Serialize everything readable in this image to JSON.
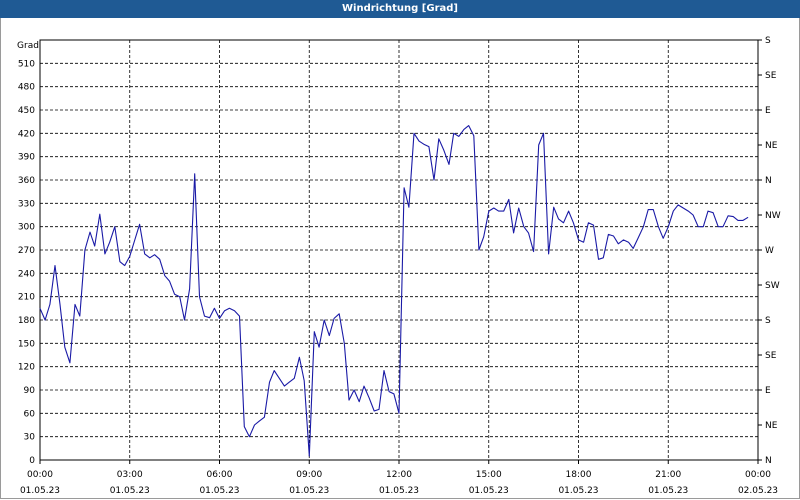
{
  "window": {
    "title": "Windrichtung [Grad]"
  },
  "chart_data": {
    "type": "line",
    "title": "Windrichtung [Grad]",
    "ylabel": "Grad",
    "ylim": [
      0,
      540
    ],
    "yticks": [
      0,
      30,
      60,
      90,
      120,
      150,
      180,
      210,
      240,
      270,
      300,
      330,
      360,
      390,
      420,
      450,
      480,
      510
    ],
    "right_axis_labels": [
      {
        "value": 0,
        "label": "N"
      },
      {
        "value": 45,
        "label": "NE"
      },
      {
        "value": 90,
        "label": "E"
      },
      {
        "value": 135,
        "label": "SE"
      },
      {
        "value": 180,
        "label": "S"
      },
      {
        "value": 225,
        "label": "SW"
      },
      {
        "value": 270,
        "label": "W"
      },
      {
        "value": 315,
        "label": "NW"
      },
      {
        "value": 360,
        "label": "N"
      },
      {
        "value": 405,
        "label": "NE"
      },
      {
        "value": 450,
        "label": "E"
      },
      {
        "value": 495,
        "label": "SE"
      },
      {
        "value": 540,
        "label": "S"
      }
    ],
    "xlim_hours": [
      0,
      24
    ],
    "xticks": [
      {
        "hour": 0,
        "time": "00:00",
        "date": "01.05.23"
      },
      {
        "hour": 3,
        "time": "03:00",
        "date": "01.05.23"
      },
      {
        "hour": 6,
        "time": "06:00",
        "date": "01.05.23"
      },
      {
        "hour": 9,
        "time": "09:00",
        "date": "01.05.23"
      },
      {
        "hour": 12,
        "time": "12:00",
        "date": "01.05.23"
      },
      {
        "hour": 15,
        "time": "15:00",
        "date": "01.05.23"
      },
      {
        "hour": 18,
        "time": "18:00",
        "date": "01.05.23"
      },
      {
        "hour": 21,
        "time": "21:00",
        "date": "01.05.23"
      },
      {
        "hour": 24,
        "time": "00:00",
        "date": "02.05.23"
      }
    ],
    "grid": true,
    "series": [
      {
        "name": "",
        "color": "#1a1aa6",
        "points": [
          [
            0.0,
            195
          ],
          [
            0.17,
            180
          ],
          [
            0.33,
            200
          ],
          [
            0.5,
            250
          ],
          [
            0.67,
            200
          ],
          [
            0.83,
            145
          ],
          [
            1.0,
            125
          ],
          [
            1.17,
            200
          ],
          [
            1.33,
            185
          ],
          [
            1.5,
            270
          ],
          [
            1.67,
            293
          ],
          [
            1.83,
            275
          ],
          [
            2.0,
            316
          ],
          [
            2.17,
            265
          ],
          [
            2.33,
            280
          ],
          [
            2.5,
            300
          ],
          [
            2.67,
            255
          ],
          [
            2.83,
            250
          ],
          [
            3.0,
            262
          ],
          [
            3.17,
            283
          ],
          [
            3.33,
            303
          ],
          [
            3.5,
            265
          ],
          [
            3.67,
            260
          ],
          [
            3.83,
            264
          ],
          [
            4.0,
            258
          ],
          [
            4.17,
            237
          ],
          [
            4.33,
            230
          ],
          [
            4.5,
            213
          ],
          [
            4.67,
            210
          ],
          [
            4.83,
            180
          ],
          [
            5.0,
            220
          ],
          [
            5.17,
            368
          ],
          [
            5.33,
            210
          ],
          [
            5.5,
            185
          ],
          [
            5.67,
            183
          ],
          [
            5.83,
            195
          ],
          [
            6.0,
            182
          ],
          [
            6.17,
            192
          ],
          [
            6.33,
            195
          ],
          [
            6.5,
            192
          ],
          [
            6.67,
            185
          ],
          [
            6.83,
            43
          ],
          [
            7.0,
            30
          ],
          [
            7.17,
            45
          ],
          [
            7.33,
            50
          ],
          [
            7.5,
            55
          ],
          [
            7.67,
            100
          ],
          [
            7.83,
            115
          ],
          [
            8.0,
            105
          ],
          [
            8.17,
            95
          ],
          [
            8.33,
            100
          ],
          [
            8.5,
            105
          ],
          [
            8.67,
            132
          ],
          [
            8.83,
            102
          ],
          [
            9.0,
            5
          ],
          [
            9.17,
            165
          ],
          [
            9.33,
            145
          ],
          [
            9.5,
            180
          ],
          [
            9.67,
            160
          ],
          [
            9.83,
            182
          ],
          [
            10.0,
            188
          ],
          [
            10.17,
            150
          ],
          [
            10.33,
            77
          ],
          [
            10.5,
            90
          ],
          [
            10.67,
            75
          ],
          [
            10.83,
            95
          ],
          [
            11.0,
            80
          ],
          [
            11.17,
            63
          ],
          [
            11.33,
            65
          ],
          [
            11.5,
            115
          ],
          [
            11.67,
            88
          ],
          [
            11.83,
            85
          ],
          [
            12.0,
            60
          ],
          [
            12.17,
            350
          ],
          [
            12.33,
            325
          ],
          [
            12.5,
            420
          ],
          [
            12.67,
            410
          ],
          [
            12.83,
            406
          ],
          [
            13.0,
            403
          ],
          [
            13.17,
            360
          ],
          [
            13.33,
            413
          ],
          [
            13.5,
            398
          ],
          [
            13.67,
            380
          ],
          [
            13.83,
            420
          ],
          [
            14.0,
            416
          ],
          [
            14.17,
            425
          ],
          [
            14.33,
            430
          ],
          [
            14.5,
            417
          ],
          [
            14.67,
            270
          ],
          [
            14.83,
            287
          ],
          [
            15.0,
            320
          ],
          [
            15.17,
            324
          ],
          [
            15.33,
            320
          ],
          [
            15.5,
            320
          ],
          [
            15.67,
            335
          ],
          [
            15.83,
            292
          ],
          [
            16.0,
            324
          ],
          [
            16.17,
            300
          ],
          [
            16.33,
            292
          ],
          [
            16.5,
            268
          ],
          [
            16.67,
            405
          ],
          [
            16.83,
            420
          ],
          [
            17.0,
            265
          ],
          [
            17.17,
            325
          ],
          [
            17.33,
            310
          ],
          [
            17.5,
            305
          ],
          [
            17.67,
            320
          ],
          [
            17.83,
            305
          ],
          [
            18.0,
            283
          ],
          [
            18.17,
            280
          ],
          [
            18.33,
            305
          ],
          [
            18.5,
            302
          ],
          [
            18.67,
            258
          ],
          [
            18.83,
            260
          ],
          [
            19.0,
            290
          ],
          [
            19.17,
            288
          ],
          [
            19.33,
            278
          ],
          [
            19.5,
            283
          ],
          [
            19.67,
            280
          ],
          [
            19.83,
            272
          ],
          [
            20.0,
            286
          ],
          [
            20.17,
            300
          ],
          [
            20.33,
            322
          ],
          [
            20.5,
            322
          ],
          [
            20.67,
            300
          ],
          [
            20.83,
            285
          ],
          [
            21.0,
            300
          ],
          [
            21.17,
            320
          ],
          [
            21.33,
            328
          ],
          [
            21.5,
            324
          ],
          [
            21.67,
            320
          ],
          [
            21.83,
            315
          ],
          [
            22.0,
            300
          ],
          [
            22.17,
            300
          ],
          [
            22.33,
            320
          ],
          [
            22.5,
            318
          ],
          [
            22.67,
            300
          ],
          [
            22.83,
            300
          ],
          [
            23.0,
            314
          ],
          [
            23.17,
            313
          ],
          [
            23.33,
            308
          ],
          [
            23.5,
            308
          ],
          [
            23.67,
            312
          ]
        ]
      }
    ]
  }
}
